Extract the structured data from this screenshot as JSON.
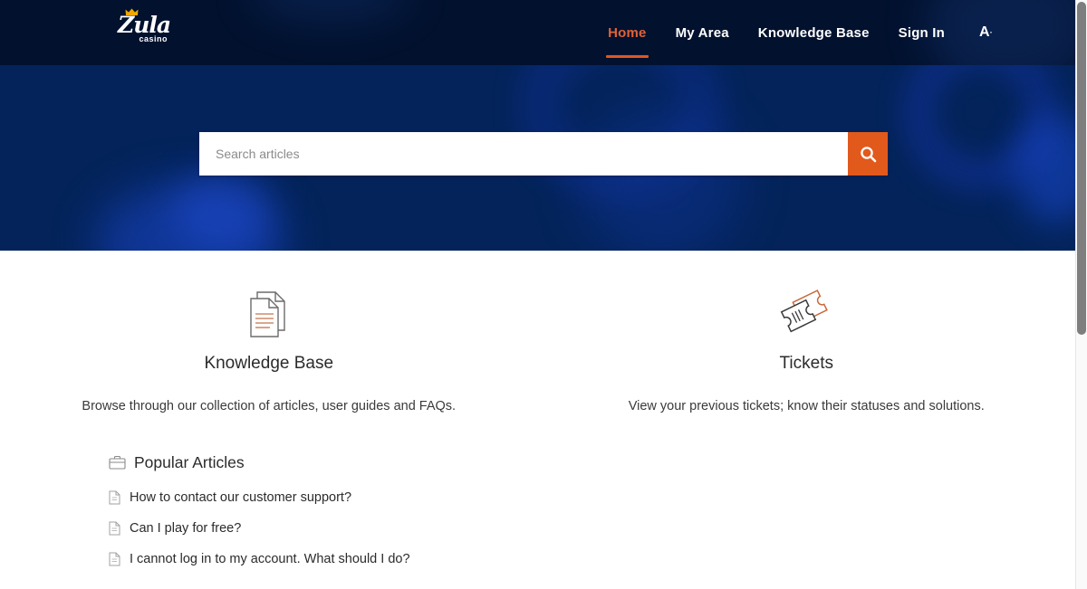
{
  "colors": {
    "header_bg": "#01112e",
    "hero_bg": "#03235a",
    "accent_orange": "#e2591c",
    "active_nav": "#e06236",
    "body_text": "#2b2b2b"
  },
  "header": {
    "logo": {
      "name_top": "Zula",
      "name_bottom": "casino",
      "crown_icon": "crown-icon"
    },
    "nav": [
      {
        "label": "Home",
        "active": true
      },
      {
        "label": "My Area",
        "active": false
      },
      {
        "label": "Knowledge Base",
        "active": false
      },
      {
        "label": "Sign In",
        "active": false
      }
    ],
    "language_selector": {
      "label": "A",
      "superscript": "·",
      "icon": "font-size-icon"
    }
  },
  "hero": {
    "search": {
      "placeholder": "Search articles",
      "value": "",
      "button_icon": "search-icon"
    }
  },
  "main": {
    "cards": [
      {
        "icon": "documents-icon",
        "title": "Knowledge Base",
        "description": "Browse through our collection of articles, user guides and FAQs."
      },
      {
        "icon": "tickets-icon",
        "title": "Tickets",
        "description": "View your previous tickets; know their statuses and solutions."
      }
    ],
    "popular_articles": {
      "icon": "briefcase-icon",
      "title": "Popular Articles",
      "items": [
        {
          "icon": "document-icon",
          "title": "How to contact our customer support?"
        },
        {
          "icon": "document-icon",
          "title": "Can I play for free?"
        },
        {
          "icon": "document-icon",
          "title": "I cannot log in to my account. What should I do?"
        }
      ]
    }
  },
  "scrollbar": {
    "position": "right",
    "thumb_top_percent": 0
  }
}
